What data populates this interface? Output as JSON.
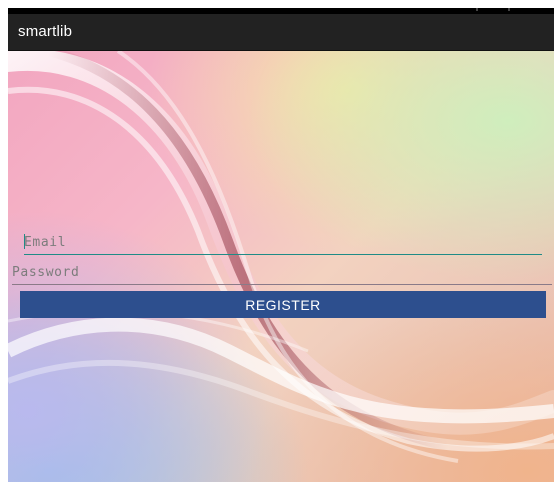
{
  "app": {
    "title": "smartlib"
  },
  "form": {
    "email": {
      "placeholder": "Email",
      "value": ""
    },
    "password": {
      "placeholder": "Password",
      "value": ""
    },
    "register_label": "REGISTER"
  },
  "colors": {
    "action_bar": "#222222",
    "button": "#2d4f8e",
    "focus_accent": "#1f8b86"
  }
}
